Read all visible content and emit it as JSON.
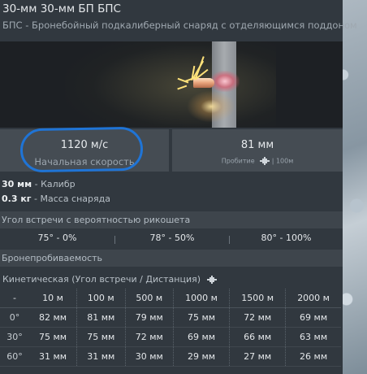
{
  "header": {
    "title": "30-мм 30-мм БП БПС",
    "subtitle": "БПС - Бронебойный подкалиберный снаряд с отделяющимся поддоном"
  },
  "stats": {
    "velocity_value": "1120 м/с",
    "velocity_label": "Начальная скорость",
    "penetration_value": "81 мм",
    "penetration_label": "Пробитие",
    "penetration_distance": "| 100м"
  },
  "properties": [
    {
      "value": "30 мм",
      "label": "- Калибр"
    },
    {
      "value": "0.3 кг",
      "label": "- Масса снаряда"
    }
  ],
  "ricochet": {
    "heading": "Угол встречи с вероятностью рикошета",
    "values": [
      "75° - 0%",
      "78° - 50%",
      "80° - 100%"
    ]
  },
  "armor": {
    "heading": "Бронепробиваемость",
    "kinetic_label": "Кинетическая (Угол встречи / Дистанция)",
    "columns": [
      "-",
      "10 м",
      "100 м",
      "500 м",
      "1000 м",
      "1500 м",
      "2000 м"
    ],
    "rows": [
      {
        "angle": "0°",
        "values": [
          "82 мм",
          "81 мм",
          "79 мм",
          "75 мм",
          "72 мм",
          "69 мм"
        ]
      },
      {
        "angle": "30°",
        "values": [
          "75 мм",
          "75 мм",
          "72 мм",
          "69 мм",
          "66 мм",
          "63 мм"
        ]
      },
      {
        "angle": "60°",
        "values": [
          "31 мм",
          "31 мм",
          "30 мм",
          "29 мм",
          "27 мм",
          "26 мм"
        ]
      }
    ]
  },
  "colors": {
    "panel_bg": "#31383f",
    "highlight_circle": "#1f74d6"
  }
}
